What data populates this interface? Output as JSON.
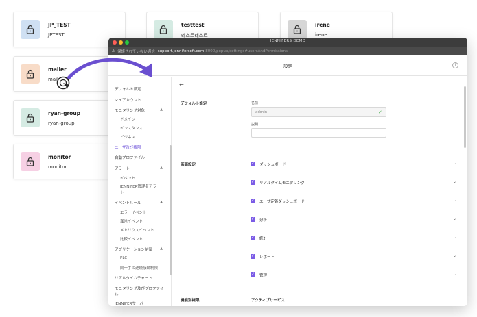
{
  "cards": [
    {
      "name": "JP_TEST",
      "sub": "JPTEST",
      "color": "#cfe0f3"
    },
    {
      "name": "testtest",
      "sub": "테스트테스트",
      "color": "#d5ebe3"
    },
    {
      "name": "irene",
      "sub": "irene",
      "color": "#d6d6d6"
    },
    {
      "name": "mailer",
      "sub": "mailer",
      "color": "#f8dcc8"
    },
    {
      "name": "ryan-group",
      "sub": "ryan-group",
      "color": "#d5ebe3"
    },
    {
      "name": "monitor",
      "sub": "monitor",
      "color": "#f6d0e4"
    }
  ],
  "window": {
    "title": "JENNIFERS DEMO",
    "url_warning": "⚠",
    "url_insecure": "保護されていない通信",
    "url_host": "support.jennifersoft.com",
    "url_path": ":8000/popup/settings#usersAndPermissions",
    "header_title": "設定",
    "info_icon": "i"
  },
  "sidebar": {
    "items": [
      {
        "label": "デフォルト設定"
      },
      {
        "label": "マイアカウント"
      },
      {
        "label": "モニタリング対象",
        "caret": "▲"
      },
      {
        "label": "ドメイン",
        "sub": true
      },
      {
        "label": "インスタンス",
        "sub": true
      },
      {
        "label": "ビジネス",
        "sub": true
      },
      {
        "label": "ユーザ及び権限",
        "active": true
      },
      {
        "label": "自動プロファイル"
      },
      {
        "label": "アラート",
        "caret": "▲"
      },
      {
        "label": "イベント",
        "sub": true
      },
      {
        "label": "JENNIFER管理者アラー",
        "sub": true
      },
      {
        "label": "ト",
        "sub": true
      },
      {
        "label": "イベントルール",
        "caret": "▲"
      },
      {
        "label": "エラーイベント",
        "sub": true
      },
      {
        "label": "異常イベント",
        "sub": true
      },
      {
        "label": "メトリクスイベント",
        "sub": true
      },
      {
        "label": "比較イベント",
        "sub": true
      },
      {
        "label": "アプリケーション制御",
        "caret": "▲"
      },
      {
        "label": "PLC",
        "sub": true
      },
      {
        "label": "同一手の連続接続制限",
        "sub": true
      },
      {
        "label": "リアルタイムチャート"
      },
      {
        "label": "モニタリング及びプロファイ"
      },
      {
        "label": "ル"
      },
      {
        "label": "JENNIFERサーバ"
      }
    ]
  },
  "main": {
    "back_icon": "←",
    "default_label": "デフォルト設定",
    "name_label": "名前",
    "name_value": "admin",
    "name_check": "✓",
    "desc_label": "説明",
    "screen_label": "画面設定",
    "checkbox_mark": "✓",
    "chevron": "⌄",
    "permissions": [
      "ダッシュボード",
      "リアルタイムモニタリング",
      "ユーザ定義ダッシュボード",
      "分析",
      "統計",
      "レポート",
      "管理"
    ],
    "bottom_left": "機能別権限",
    "bottom_right": "アクティブサービス"
  },
  "colors": {
    "accent": "#7b5ce6",
    "arrow": "#6a4fd0"
  }
}
